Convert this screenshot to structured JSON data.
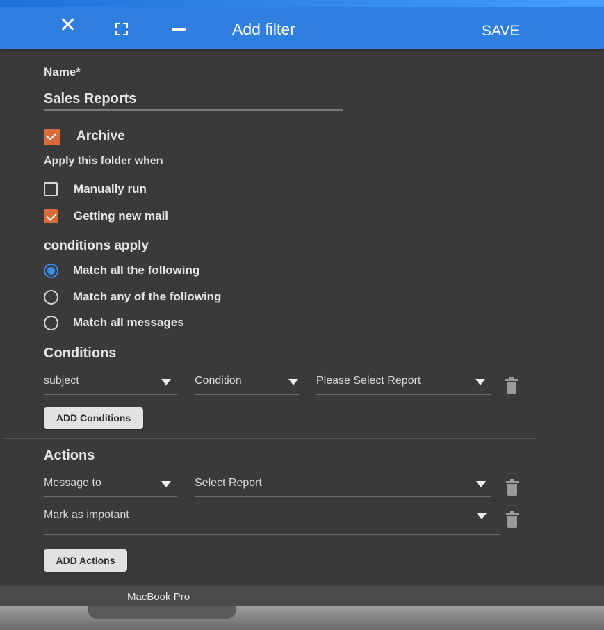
{
  "header": {
    "title": "Add filter",
    "save_label": "SAVE"
  },
  "form": {
    "name_label": "Name*",
    "name_value": "Sales Reports",
    "archive": {
      "label": "Archive",
      "checked": true
    },
    "apply_heading": "Apply this folder when",
    "apply_options": [
      {
        "label": "Manually run",
        "checked": false
      },
      {
        "label": "Getting new mail",
        "checked": true
      }
    ],
    "conditions_apply_heading": "conditions apply",
    "match_options": [
      {
        "label": "Match all the following",
        "selected": true
      },
      {
        "label": "Match any of the following",
        "selected": false
      },
      {
        "label": "Match all messages",
        "selected": false
      }
    ]
  },
  "conditions": {
    "heading": "Conditions",
    "row": {
      "field": "subject",
      "operator": "Condition",
      "value": "Please Select Report"
    },
    "add_button": "ADD Conditions"
  },
  "actions": {
    "heading": "Actions",
    "rows": [
      {
        "action": "Message to",
        "target": "Select Report"
      },
      {
        "action": "Mark as impotant"
      }
    ],
    "add_button": "ADD Actions"
  },
  "footer": {
    "device_label": "MacBook Pro"
  },
  "colors": {
    "header_bg": "#2f7fe0",
    "body_bg": "#3a3a3a",
    "checkbox_accent": "#d96b3a",
    "radio_accent": "#3a8df0"
  }
}
